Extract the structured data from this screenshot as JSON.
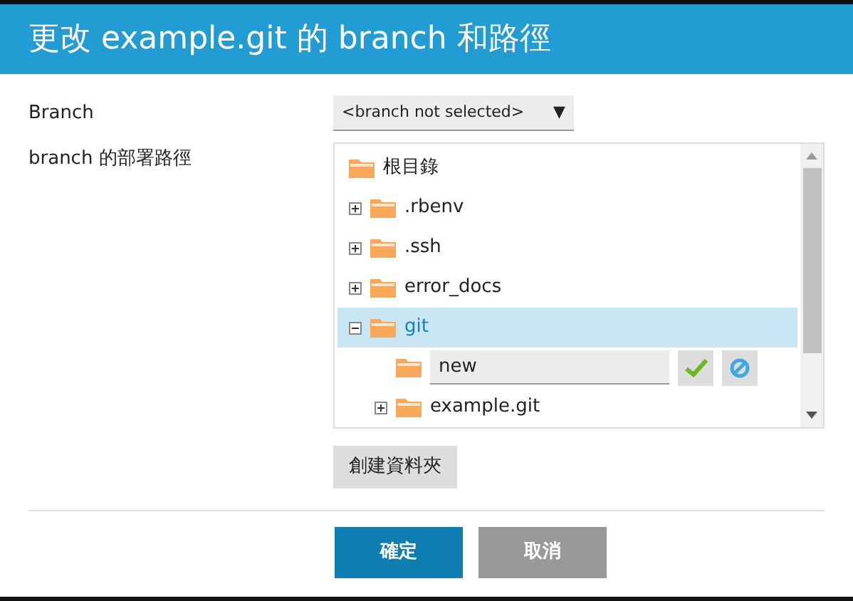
{
  "dialog": {
    "title": "更改 example.git 的 branch 和路徑"
  },
  "branch_field": {
    "label": "Branch",
    "value": "<branch not selected>",
    "arrow": "▼"
  },
  "path_field": {
    "label": "branch 的部署路徑"
  },
  "tree": [
    {
      "kind": "root",
      "name": "根目錄",
      "selected": false,
      "children": [
        {
          "kind": "folder",
          "name": ".rbenv",
          "expanded": false,
          "selected": false
        },
        {
          "kind": "folder",
          "name": ".ssh",
          "expanded": false,
          "selected": false
        },
        {
          "kind": "folder",
          "name": "error_docs",
          "expanded": false,
          "selected": false
        },
        {
          "kind": "folder",
          "name": "git",
          "expanded": true,
          "selected": true,
          "children": [
            {
              "kind": "new-folder",
              "value": "new"
            },
            {
              "kind": "folder",
              "name": "example.git",
              "expanded": false,
              "selected": false
            }
          ]
        }
      ]
    }
  ],
  "create_folder_button": "創建資料夾",
  "buttons": [
    {
      "label": "確定",
      "kind": "primary"
    },
    {
      "label": "取消",
      "kind": "secondary"
    }
  ]
}
